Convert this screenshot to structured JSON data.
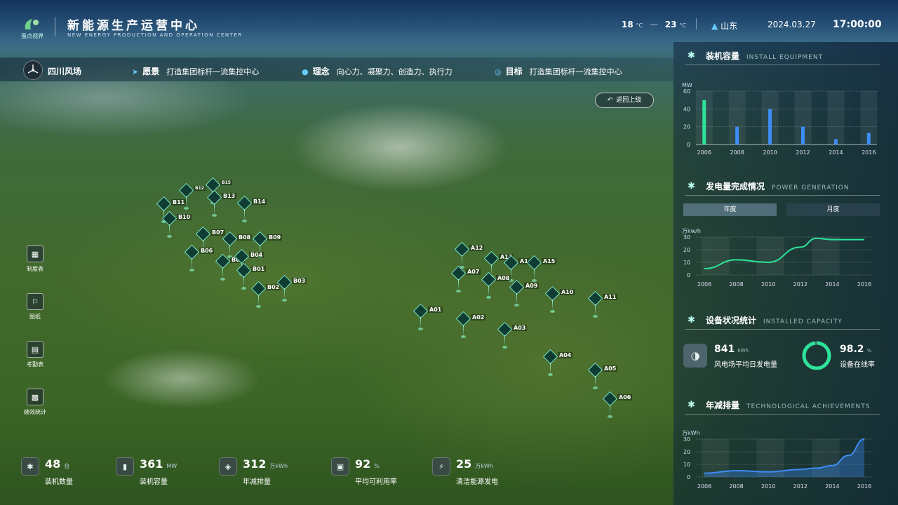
{
  "header": {
    "logo_text": "蛋点视界",
    "title": "新能源生产运营中心",
    "subtitle": "NEW ENERGY PRODUCTION AND OPERATION CENTER",
    "temp_low": "18",
    "temp_high": "23",
    "temp_unit": "°C",
    "temp_sep": "—",
    "location": "山东",
    "date": "2024.03.27",
    "time": "17:00:00"
  },
  "banner": {
    "farm_name": "四川风场",
    "vision_label": "愿景",
    "vision_text": "打造集团标杆一流集控中心",
    "concept_label": "理念",
    "concept_text": "向心力、凝聚力、创造力、执行力",
    "goal_label": "目标",
    "goal_text": "打造集团标杆一流集控中心"
  },
  "back_button": "返回上级",
  "sidebar": [
    {
      "label": "制度表",
      "icon": "building-icon"
    },
    {
      "label": "图纸",
      "icon": "map-icon"
    },
    {
      "label": "考勤表",
      "icon": "calendar-icon"
    },
    {
      "label": "绩效统计",
      "icon": "bar-chart-icon"
    }
  ],
  "turbines": [
    "B12",
    "B15",
    "B11",
    "B13",
    "B14",
    "B10",
    "B07",
    "B08",
    "B09",
    "B06",
    "B05",
    "B04",
    "B01",
    "B02",
    "B03",
    "A12",
    "A13",
    "A14",
    "A15",
    "A07",
    "A08",
    "A09",
    "A10",
    "A11",
    "A01",
    "A02",
    "A03",
    "A04",
    "A05",
    "A06"
  ],
  "bottom_stats": [
    {
      "value": "48",
      "unit": "台",
      "label": "装机数量",
      "icon": "turbine-icon"
    },
    {
      "value": "361",
      "unit": "MW",
      "label": "装机容量",
      "icon": "bar-icon"
    },
    {
      "value": "312",
      "unit": "万kWh",
      "label": "年减排量",
      "icon": "drop-icon"
    },
    {
      "value": "92",
      "unit": "%",
      "label": "平均可利用率",
      "icon": "box-icon"
    },
    {
      "value": "25",
      "unit": "万kWh",
      "label": "清洁能源发电",
      "icon": "lightning-icon"
    }
  ],
  "right_panel": {
    "install": {
      "title": "装机容量",
      "title_en": "INSTALL EQUIPMENT",
      "unit": "MW"
    },
    "power": {
      "title": "发电量完成情况",
      "title_en": "POWER GENERATION",
      "tab_year": "年度",
      "tab_month": "月度",
      "unit": "万kw/h"
    },
    "device": {
      "title": "设备状况统计",
      "title_en": "INSTALLED CAPACITY",
      "daily_value": "841",
      "daily_unit": "KWh",
      "daily_label": "风电场平均日发电量",
      "online_value": "98.2",
      "online_unit": "%",
      "online_label": "设备在线率",
      "online_pct": 98.2
    },
    "emission": {
      "title": "年减排量",
      "title_en": "TECHNOLOGICAL ACHIEVEMENTS",
      "unit": "万kWh"
    }
  },
  "chart_data": [
    {
      "type": "bar",
      "title": "装机容量",
      "ylabel": "MW",
      "categories": [
        "2006",
        "2007",
        "2008",
        "2009",
        "2010",
        "2011",
        "2012",
        "2013",
        "2014",
        "2015",
        "2016"
      ],
      "values": [
        50,
        0,
        20,
        0,
        40,
        0,
        20,
        0,
        6,
        0,
        13
      ],
      "x_ticks": [
        "2006",
        "2008",
        "2010",
        "2012",
        "2014",
        "2016"
      ],
      "y_ticks": [
        0,
        20,
        40,
        60
      ],
      "ylim": [
        0,
        60
      ]
    },
    {
      "type": "line",
      "title": "发电量完成情况",
      "ylabel": "万kw/h",
      "x": [
        2006,
        2008,
        2010,
        2012,
        2013,
        2014,
        2016
      ],
      "values": [
        5,
        12,
        10,
        22,
        29,
        28,
        28
      ],
      "x_ticks": [
        "2006",
        "2008",
        "2010",
        "2012",
        "2014",
        "2016"
      ],
      "y_ticks": [
        0,
        10,
        20,
        30
      ],
      "ylim": [
        0,
        30
      ]
    },
    {
      "type": "area",
      "title": "年减排量",
      "ylabel": "万kWh",
      "x": [
        2006,
        2008,
        2010,
        2012,
        2013,
        2014,
        2015,
        2016
      ],
      "values": [
        3,
        5,
        4,
        6,
        7,
        9,
        17,
        30
      ],
      "x_ticks": [
        "2006",
        "2008",
        "2010",
        "2012",
        "2014",
        "2016"
      ],
      "y_ticks": [
        0,
        10,
        20,
        30
      ],
      "ylim": [
        0,
        30
      ]
    }
  ],
  "colors": {
    "accent": "#2de39a",
    "bar_blue": "#3d8df5",
    "panel": "#0e243a"
  }
}
